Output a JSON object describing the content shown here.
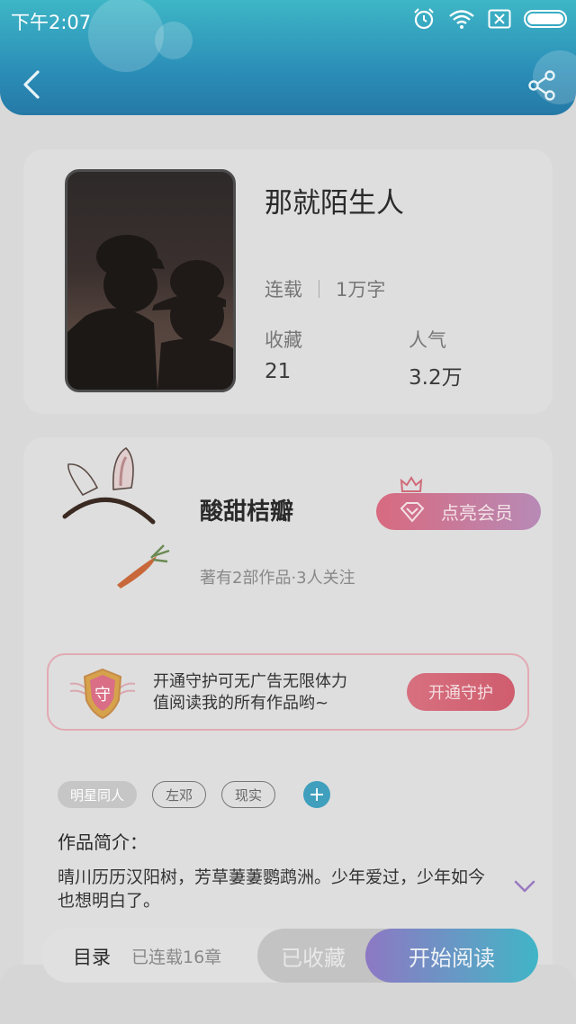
{
  "status_bar": {
    "time": "下午2:07"
  },
  "book": {
    "title": "那就陌生人",
    "status": "连载",
    "word_count": "1万字",
    "favorites_label": "收藏",
    "favorites_value": "21",
    "popularity_label": "人气",
    "popularity_value": "3.2万"
  },
  "author": {
    "name": "酸甜桔瓣",
    "summary": "著有2部作品·3人关注",
    "vip_button": "点亮会员"
  },
  "guard": {
    "badge_char": "守",
    "line1": "开通守护可无广告无限体力",
    "line2": "值阅读我的所有作品哟~",
    "button": "开通守护"
  },
  "tags": [
    "明星同人",
    "左邓",
    "现实"
  ],
  "tag_add": "+",
  "intro": {
    "heading": "作品简介：",
    "text": "晴川历历汉阳树，芳草萋萋鹦鹉洲。少年爱过，少年如今也想明白了。"
  },
  "bottom": {
    "toc": "目录",
    "chapters": "已连载16章",
    "collected": "已收藏",
    "read": "开始阅读"
  },
  "colors": {
    "header_gradient_top": "#3eb6c6",
    "header_gradient_bottom": "#2579a6",
    "vip_pink": "#d86a80",
    "guard_red": "#cf5d6e",
    "read_gradient_start": "#8d78c4",
    "read_gradient_end": "#3fb5c7",
    "tag_add_blue": "#3f9fbd"
  },
  "icons": [
    "alarm-icon",
    "wifi-icon",
    "sim-icon",
    "battery-icon",
    "back-icon",
    "share-icon",
    "diamond-icon",
    "crown-icon",
    "shield-icon",
    "chevron-down-icon"
  ]
}
